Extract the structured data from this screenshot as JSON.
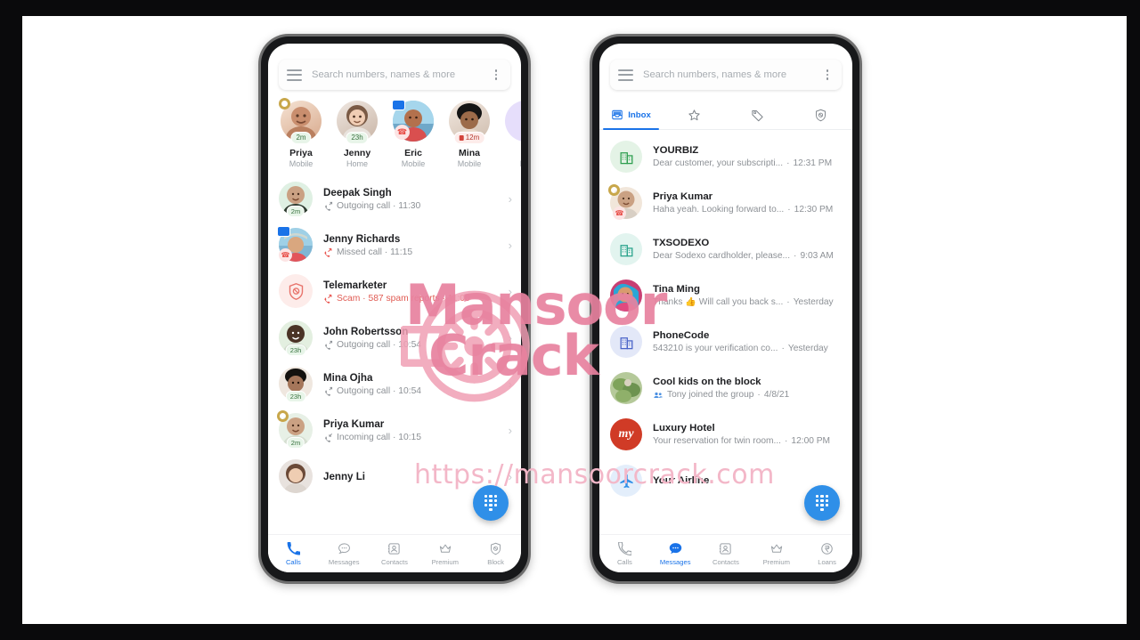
{
  "watermark": {
    "line1": "Mansoor",
    "line2": "Crack",
    "url": "https://mansoorcrack.com",
    "logo_icon": "wheel-logo-icon",
    "color": "#e8829f"
  },
  "accent_color": "#1a73e8",
  "phones": [
    {
      "id": "calls-screen",
      "search": {
        "placeholder": "Search numbers, names & more",
        "menu_icon": "hamburger-menu-icon",
        "overflow_icon": "kebab-menu-icon"
      },
      "favorites": [
        {
          "name": "Priya",
          "type": "Mobile",
          "badge": "2m",
          "badge_style": "green",
          "marker": "crown-icon"
        },
        {
          "name": "Jenny",
          "type": "Home",
          "badge": "23h",
          "badge_style": "green",
          "marker": ""
        },
        {
          "name": "Eric",
          "type": "Mobile",
          "badge": "",
          "badge_style": "",
          "marker": "message-badge-icon"
        },
        {
          "name": "Mina",
          "type": "Mobile",
          "badge": "12m",
          "badge_style": "red",
          "marker": ""
        },
        {
          "name": "M",
          "type": "Mo",
          "badge": "",
          "badge_style": "",
          "marker": ""
        }
      ],
      "calls": [
        {
          "name": "Deepak Singh",
          "meta": "Outgoing call · 11:30",
          "icon": "outgoing-call-icon",
          "badge": "2m",
          "spam": false
        },
        {
          "name": "Jenny Richards",
          "meta": "Missed call · 11:15",
          "icon": "missed-call-icon",
          "badge": "",
          "spam": false
        },
        {
          "name": "Telemarketer",
          "meta": "Scam · 587 spam reports · 11:00",
          "icon": "missed-call-icon",
          "badge": "",
          "spam": true
        },
        {
          "name": "John Robertsson",
          "meta": "Outgoing call · 10:54",
          "icon": "outgoing-call-icon",
          "badge": "23h",
          "spam": false
        },
        {
          "name": "Mina Ojha",
          "meta": "Outgoing call · 10:54",
          "icon": "outgoing-call-icon",
          "badge": "23h",
          "spam": false
        },
        {
          "name": "Priya Kumar",
          "meta": "Incoming call · 10:15",
          "icon": "incoming-call-icon",
          "badge": "2m",
          "spam": false
        },
        {
          "name": "Jenny Li",
          "meta": "",
          "icon": "",
          "badge": "",
          "spam": false
        }
      ],
      "fab_icon": "dialpad-icon",
      "bottom_nav": [
        {
          "label": "Calls",
          "icon": "phone-icon",
          "active": true
        },
        {
          "label": "Messages",
          "icon": "chat-icon",
          "active": false
        },
        {
          "label": "Contacts",
          "icon": "contacts-icon",
          "active": false
        },
        {
          "label": "Premium",
          "icon": "crown-icon",
          "active": false
        },
        {
          "label": "Block",
          "icon": "shield-icon",
          "active": false
        }
      ]
    },
    {
      "id": "messages-screen",
      "search": {
        "placeholder": "Search numbers, names & more",
        "menu_icon": "hamburger-menu-icon",
        "overflow_icon": "kebab-menu-icon"
      },
      "tabs": [
        {
          "label": "Inbox",
          "icon": "inbox-icon",
          "active": true
        },
        {
          "label": "",
          "icon": "star-icon",
          "active": false
        },
        {
          "label": "",
          "icon": "tag-icon",
          "active": false
        },
        {
          "label": "",
          "icon": "shield-icon",
          "active": false
        }
      ],
      "messages": [
        {
          "name": "YOURBIZ",
          "snippet": "Dear customer, your subscripti...",
          "time": "12:31 PM",
          "avatar": "business-green-icon"
        },
        {
          "name": "Priya Kumar",
          "snippet": "Haha yeah. Looking forward to...",
          "time": "12:30 PM",
          "avatar": "photo-priya"
        },
        {
          "name": "TXSODEXO",
          "snippet": "Dear Sodexo cardholder, please...",
          "time": "9:03 AM",
          "avatar": "business-teal-icon"
        },
        {
          "name": "Tina Ming",
          "snippet": "Thanks 👍 Will call you back s...",
          "time": "Yesterday",
          "avatar": "photo-tina"
        },
        {
          "name": "PhoneCode",
          "snippet": "543210 is your verification co...",
          "time": "Yesterday",
          "avatar": "business-blue-icon"
        },
        {
          "name": "Cool kids on the block",
          "snippet": "Tony joined the group",
          "time": "4/8/21",
          "avatar": "photo-group",
          "prefix_icon": "group-icon"
        },
        {
          "name": "Luxury Hotel",
          "snippet": "Your reservation for twin room...",
          "time": "12:00 PM",
          "avatar": "logo-my-red"
        },
        {
          "name": "Your Airline",
          "snippet": "",
          "time": "",
          "avatar": "airplane-icon"
        }
      ],
      "fab_icon": "dialpad-icon",
      "bottom_nav": [
        {
          "label": "Calls",
          "icon": "phone-icon",
          "active": false
        },
        {
          "label": "Messages",
          "icon": "chat-icon",
          "active": true
        },
        {
          "label": "Contacts",
          "icon": "contacts-icon",
          "active": false
        },
        {
          "label": "Premium",
          "icon": "crown-icon",
          "active": false
        },
        {
          "label": "Loans",
          "icon": "rupee-icon",
          "active": false
        }
      ]
    }
  ]
}
